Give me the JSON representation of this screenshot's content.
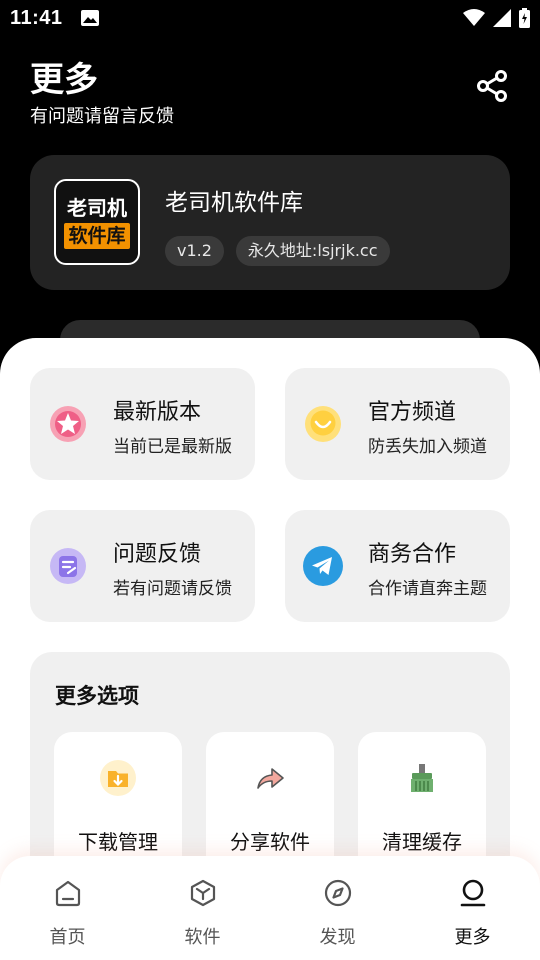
{
  "status_bar": {
    "time": "11:41"
  },
  "header": {
    "title": "更多",
    "subtitle": "有问题请留言反馈"
  },
  "app_card": {
    "logo_top": "老司机",
    "logo_bottom": "软件库",
    "name": "老司机软件库",
    "version": "v1.2",
    "address": "永久地址:lsjrjk.cc"
  },
  "tiles": [
    {
      "title": "最新版本",
      "subtitle": "当前已是最新版",
      "icon": "star-icon"
    },
    {
      "title": "官方频道",
      "subtitle": "防丢失加入频道",
      "icon": "chat-bubble-icon"
    },
    {
      "title": "问题反馈",
      "subtitle": "若有问题请反馈",
      "icon": "feedback-doc-icon"
    },
    {
      "title": "商务合作",
      "subtitle": "合作请直奔主题",
      "icon": "telegram-icon"
    }
  ],
  "more_options": {
    "title": "更多选项",
    "items": [
      {
        "label": "下载管理",
        "icon": "download-folder-icon"
      },
      {
        "label": "分享软件",
        "icon": "share-arrow-icon"
      },
      {
        "label": "清理缓存",
        "icon": "broom-icon"
      }
    ]
  },
  "nav": [
    {
      "label": "首页",
      "icon": "home-icon"
    },
    {
      "label": "软件",
      "icon": "box-icon"
    },
    {
      "label": "发现",
      "icon": "compass-icon"
    },
    {
      "label": "更多",
      "icon": "profile-icon"
    }
  ],
  "colors": {
    "accent_orange": "#f29100",
    "telegram_blue": "#2a9be0",
    "dark_card": "#232323"
  }
}
